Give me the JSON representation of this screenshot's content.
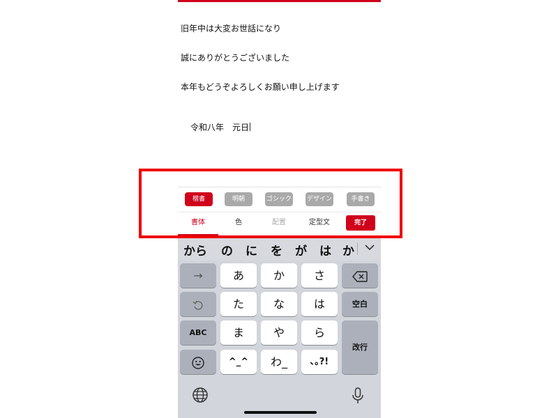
{
  "letter": {
    "lines": [
      "旧年中は大変お世話になり",
      "誠にありがとうございました",
      "本年もどうぞよろしくお願い申し上げます"
    ],
    "signature": "令和八年　元日"
  },
  "toolbar": {
    "font_options": [
      {
        "label": "楷書",
        "active": true
      },
      {
        "label": "明朝",
        "active": false
      },
      {
        "label": "ゴシック",
        "active": false
      },
      {
        "label": "デザイン",
        "active": false
      },
      {
        "label": "手書き",
        "active": false
      }
    ],
    "tabs": [
      {
        "label": "書体",
        "state": "active"
      },
      {
        "label": "色",
        "state": "normal"
      },
      {
        "label": "配置",
        "state": "disabled"
      },
      {
        "label": "定型文",
        "state": "normal"
      }
    ],
    "done_label": "完了"
  },
  "keyboard": {
    "suggestions": [
      "から",
      "の",
      "に",
      "を",
      "が",
      "は",
      "か"
    ],
    "collapse_icon": "chevron-down-icon",
    "rows": [
      {
        "left": "→",
        "keys": [
          "あ",
          "か",
          "さ"
        ],
        "right_icon": "backspace-icon"
      },
      {
        "left_icon": "undo-icon",
        "keys": [
          "た",
          "な",
          "は"
        ],
        "right": "空白"
      },
      {
        "left": "ABC",
        "keys": [
          "ま",
          "や",
          "ら"
        ],
        "right": "改行"
      },
      {
        "left_icon": "emoji-icon",
        "keys": [
          "^_^",
          "わ_",
          "､｡?!"
        ]
      }
    ],
    "bottom_icons": [
      "globe-icon",
      "microphone-icon"
    ]
  },
  "colors": {
    "accent": "#d0021b",
    "highlight": "#ee0000",
    "inactive_chip": "#a9a9a9"
  }
}
